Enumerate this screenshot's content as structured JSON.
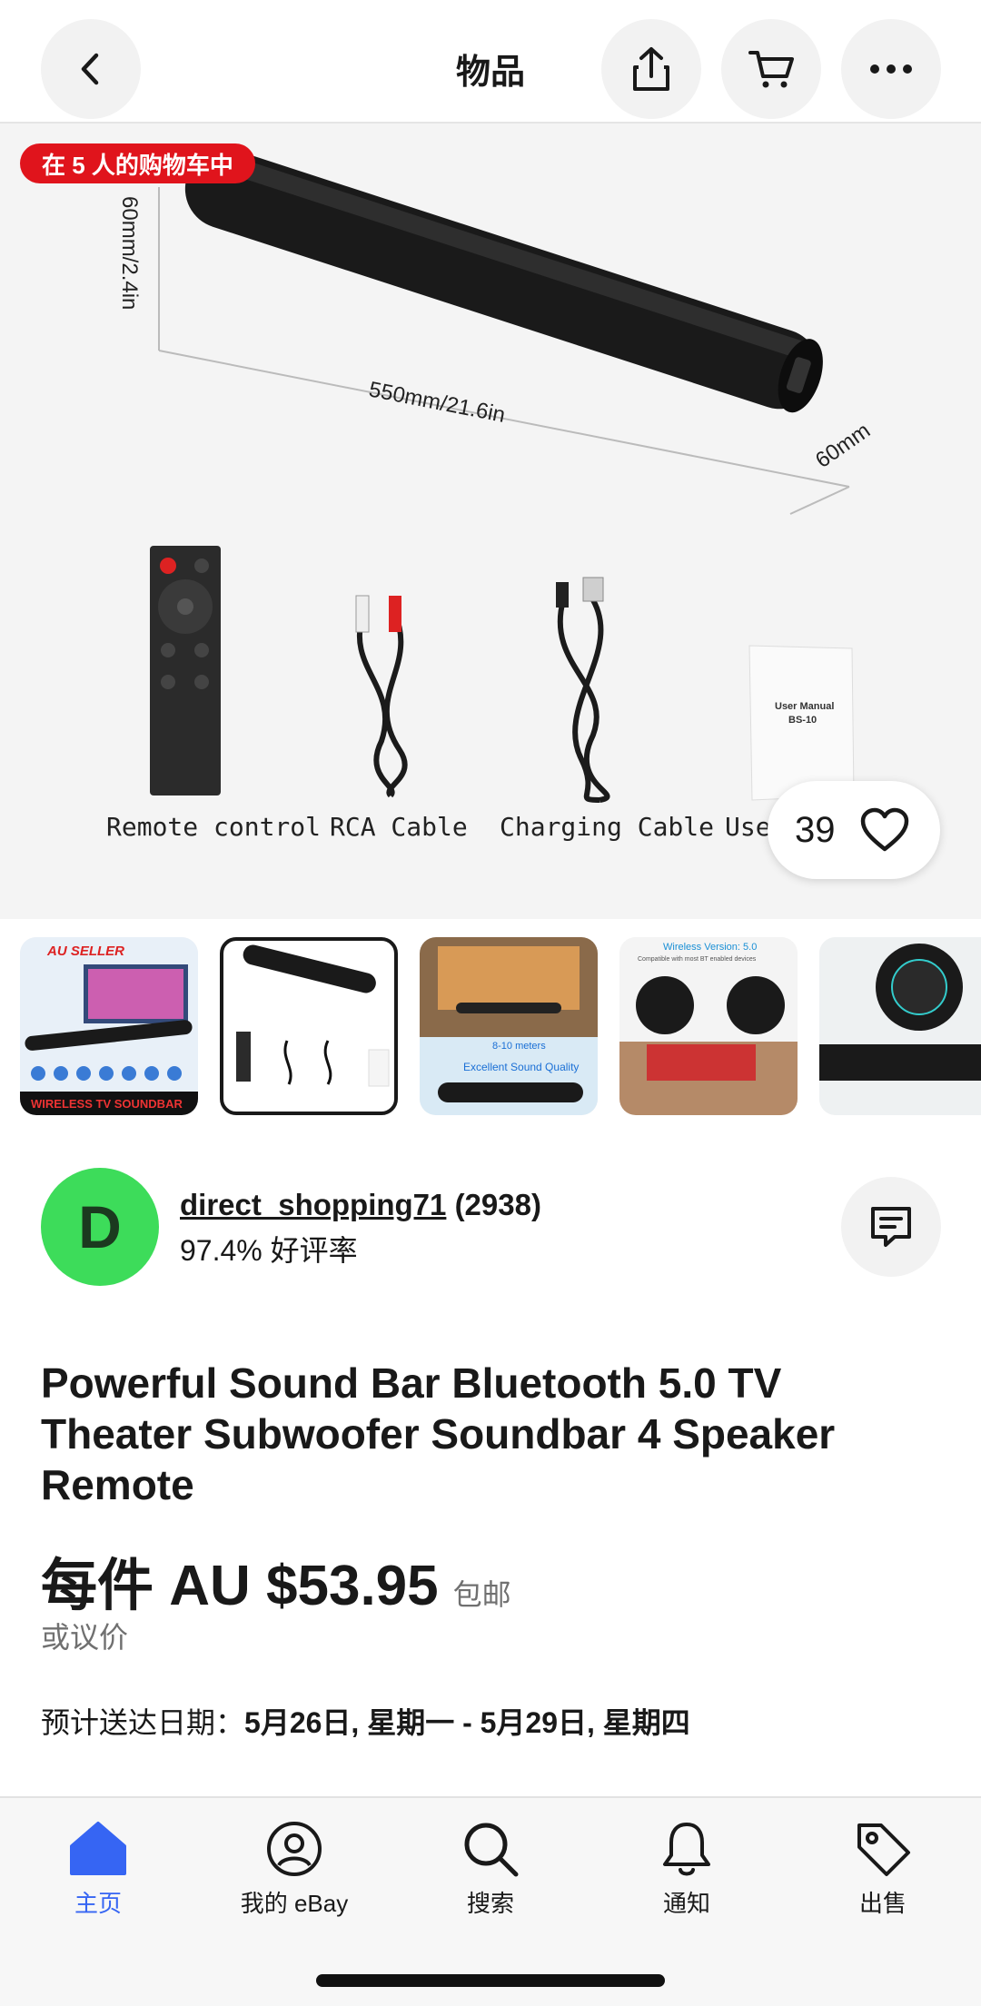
{
  "header": {
    "title": "物品"
  },
  "hero": {
    "cart_badge": "在 5 人的购物车中",
    "dim_height": "60mm/2.4in",
    "dim_length": "550mm/21.6in",
    "dim_depth": "60mm",
    "manual_line1": "User Manual",
    "manual_line2": "BS-10",
    "captions": [
      "Remote control",
      "RCA Cable",
      "Charging Cable",
      "Use"
    ],
    "like_count": "39"
  },
  "thumbnails": {
    "t1_banner": "AU SELLER",
    "t1_footer": "WIRELESS TV SOUNDBAR",
    "t3_caption": "8-10 meters",
    "t3_quality": "Excellent Sound Quality",
    "t4_title": "Wireless Version: 5.0",
    "t4_sub": "Compatible with most BT enabled devices"
  },
  "seller": {
    "initial": "D",
    "name": "direct_shopping71",
    "feedback_count": "(2938)",
    "rating": "97.4% 好评率"
  },
  "item": {
    "title": "Powerful Sound Bar Bluetooth 5.0 TV Theater Subwoofer Soundbar 4 Speaker Remote",
    "price": "每件 AU $53.95",
    "shipping": "包邮",
    "offer": "或议价",
    "delivery_label": "预计送达日期：",
    "delivery_dates": "5月26日, 星期一 - 5月29日, 星期四"
  },
  "nav": {
    "items": [
      {
        "label": "主页"
      },
      {
        "label": "我的 eBay"
      },
      {
        "label": "搜索"
      },
      {
        "label": "通知"
      },
      {
        "label": "出售"
      }
    ]
  },
  "colors": {
    "accent": "#3665f3",
    "badge": "#e0141c",
    "avatar": "#3ddc5a"
  }
}
